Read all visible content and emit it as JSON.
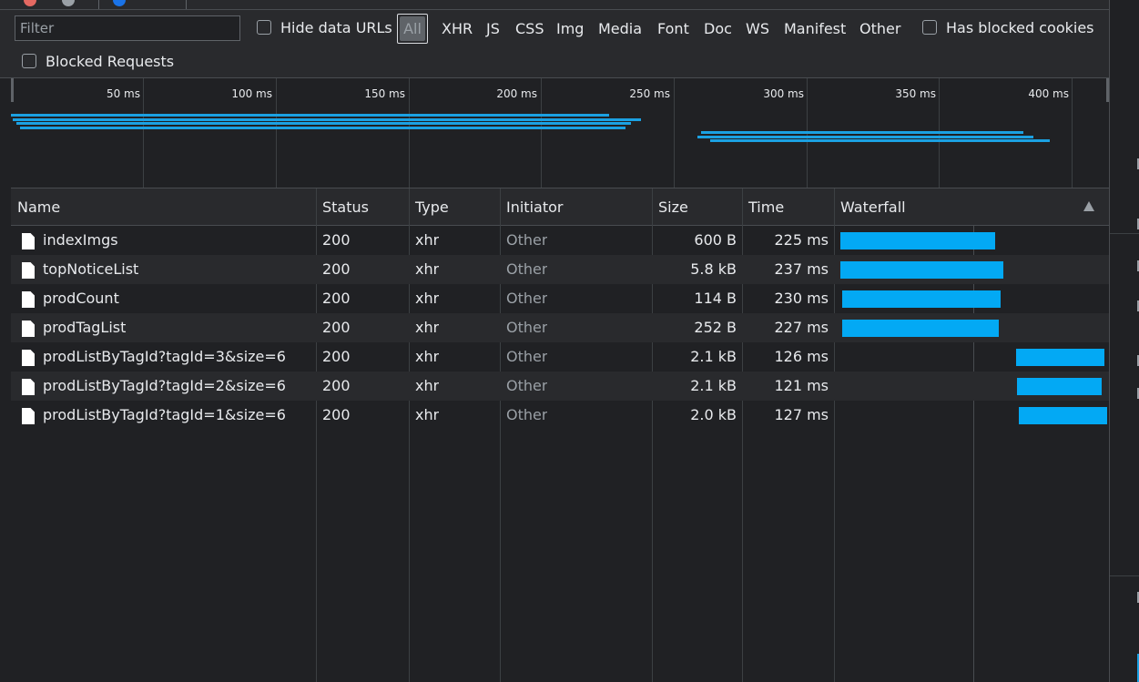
{
  "toolbar": {
    "filter_placeholder": "Filter",
    "hide_data_urls": "Hide data URLs",
    "type_filters": [
      "All",
      "XHR",
      "JS",
      "CSS",
      "Img",
      "Media",
      "Font",
      "Doc",
      "WS",
      "Manifest",
      "Other"
    ],
    "selected_type": "All",
    "has_blocked_cookies": "Has blocked cookies",
    "blocked_requests": "Blocked Requests"
  },
  "overview": {
    "ticks": [
      "50 ms",
      "100 ms",
      "150 ms",
      "200 ms",
      "250 ms",
      "300 ms",
      "350 ms",
      "400 ms"
    ],
    "bar_color": "#1ba1e2"
  },
  "table": {
    "columns": [
      "Name",
      "Status",
      "Type",
      "Initiator",
      "Size",
      "Time",
      "Waterfall"
    ],
    "sort_indicator": "up-arrow-icon",
    "rows": [
      {
        "name": "indexImgs",
        "status": "200",
        "type": "xhr",
        "initiator": "Other",
        "size": "600 B",
        "time": "225 ms"
      },
      {
        "name": "topNoticeList",
        "status": "200",
        "type": "xhr",
        "initiator": "Other",
        "size": "5.8 kB",
        "time": "237 ms"
      },
      {
        "name": "prodCount",
        "status": "200",
        "type": "xhr",
        "initiator": "Other",
        "size": "114 B",
        "time": "230 ms"
      },
      {
        "name": "prodTagList",
        "status": "200",
        "type": "xhr",
        "initiator": "Other",
        "size": "252 B",
        "time": "227 ms"
      },
      {
        "name": "prodListByTagId?tagId=3&size=6",
        "status": "200",
        "type": "xhr",
        "initiator": "Other",
        "size": "2.1 kB",
        "time": "126 ms"
      },
      {
        "name": "prodListByTagId?tagId=2&size=6",
        "status": "200",
        "type": "xhr",
        "initiator": "Other",
        "size": "2.1 kB",
        "time": "121 ms"
      },
      {
        "name": "prodListByTagId?tagId=1&size=6",
        "status": "200",
        "type": "xhr",
        "initiator": "Other",
        "size": "2.0 kB",
        "time": "127 ms"
      }
    ]
  },
  "colors": {
    "background": "#202124",
    "toolbar": "#292a2d",
    "waterfall_bar": "#03a9f4",
    "text": "#e8eaed",
    "dim_text": "#9aa0a6"
  }
}
